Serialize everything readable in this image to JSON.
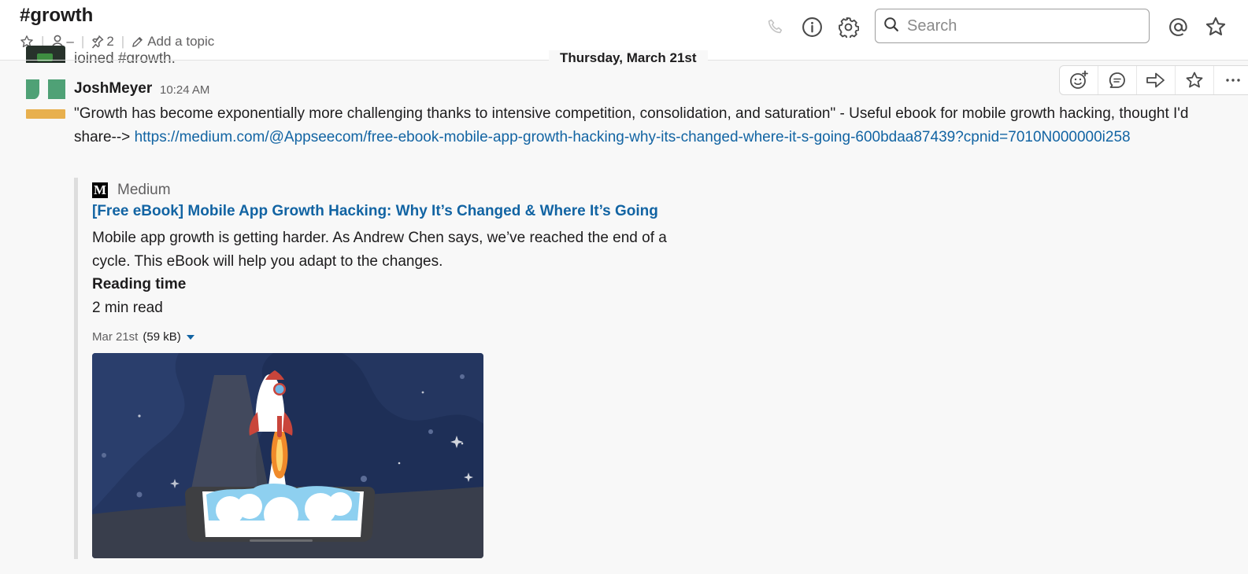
{
  "header": {
    "channel": "#growth",
    "members_count": "–",
    "pins_count": "2",
    "add_topic": "Add a topic",
    "search_placeholder": "Search"
  },
  "divider": {
    "date": "Thursday, March 21st"
  },
  "previous_message": {
    "text": "joined #growth."
  },
  "message": {
    "author": "JoshMeyer",
    "time": "10:24 AM",
    "text": "\"Growth has become exponentially more challenging thanks to intensive competition, consolidation, and saturation\" - Useful ebook for mobile growth hacking, thought I'd share-->",
    "link": "https://medium.com/@Appseecom/free-ebook-mobile-app-growth-hacking-why-its-changed-where-it-s-going-600bdaa87439?cpnid=7010N000000i258",
    "attachment": {
      "service": "Medium",
      "service_logo": "M",
      "title": "[Free eBook] Mobile App Growth Hacking: Why It’s Changed & Where It’s Going",
      "description": "Mobile app growth is getting harder. As Andrew Chen says, we’ve reached the end of a cycle. This eBook will help you adapt to the changes.",
      "field_title": "Reading time",
      "field_value": "2 min read",
      "file_date": "Mar 21st",
      "file_size": "(59 kB)"
    }
  },
  "icons": {
    "header": [
      "star-icon",
      "person-icon",
      "pin-icon",
      "pencil-icon",
      "phone-icon",
      "info-icon",
      "gear-icon",
      "search-icon",
      "at-icon",
      "star-icon"
    ],
    "actions": [
      "add-reaction-icon",
      "reply-thread-icon",
      "share-icon",
      "star-icon",
      "more-icon"
    ]
  },
  "colors": {
    "link": "#1264a3",
    "background": "#f8f8f8",
    "avatar_green": "#4fa176",
    "avatar_yellow": "#e8b04e"
  }
}
